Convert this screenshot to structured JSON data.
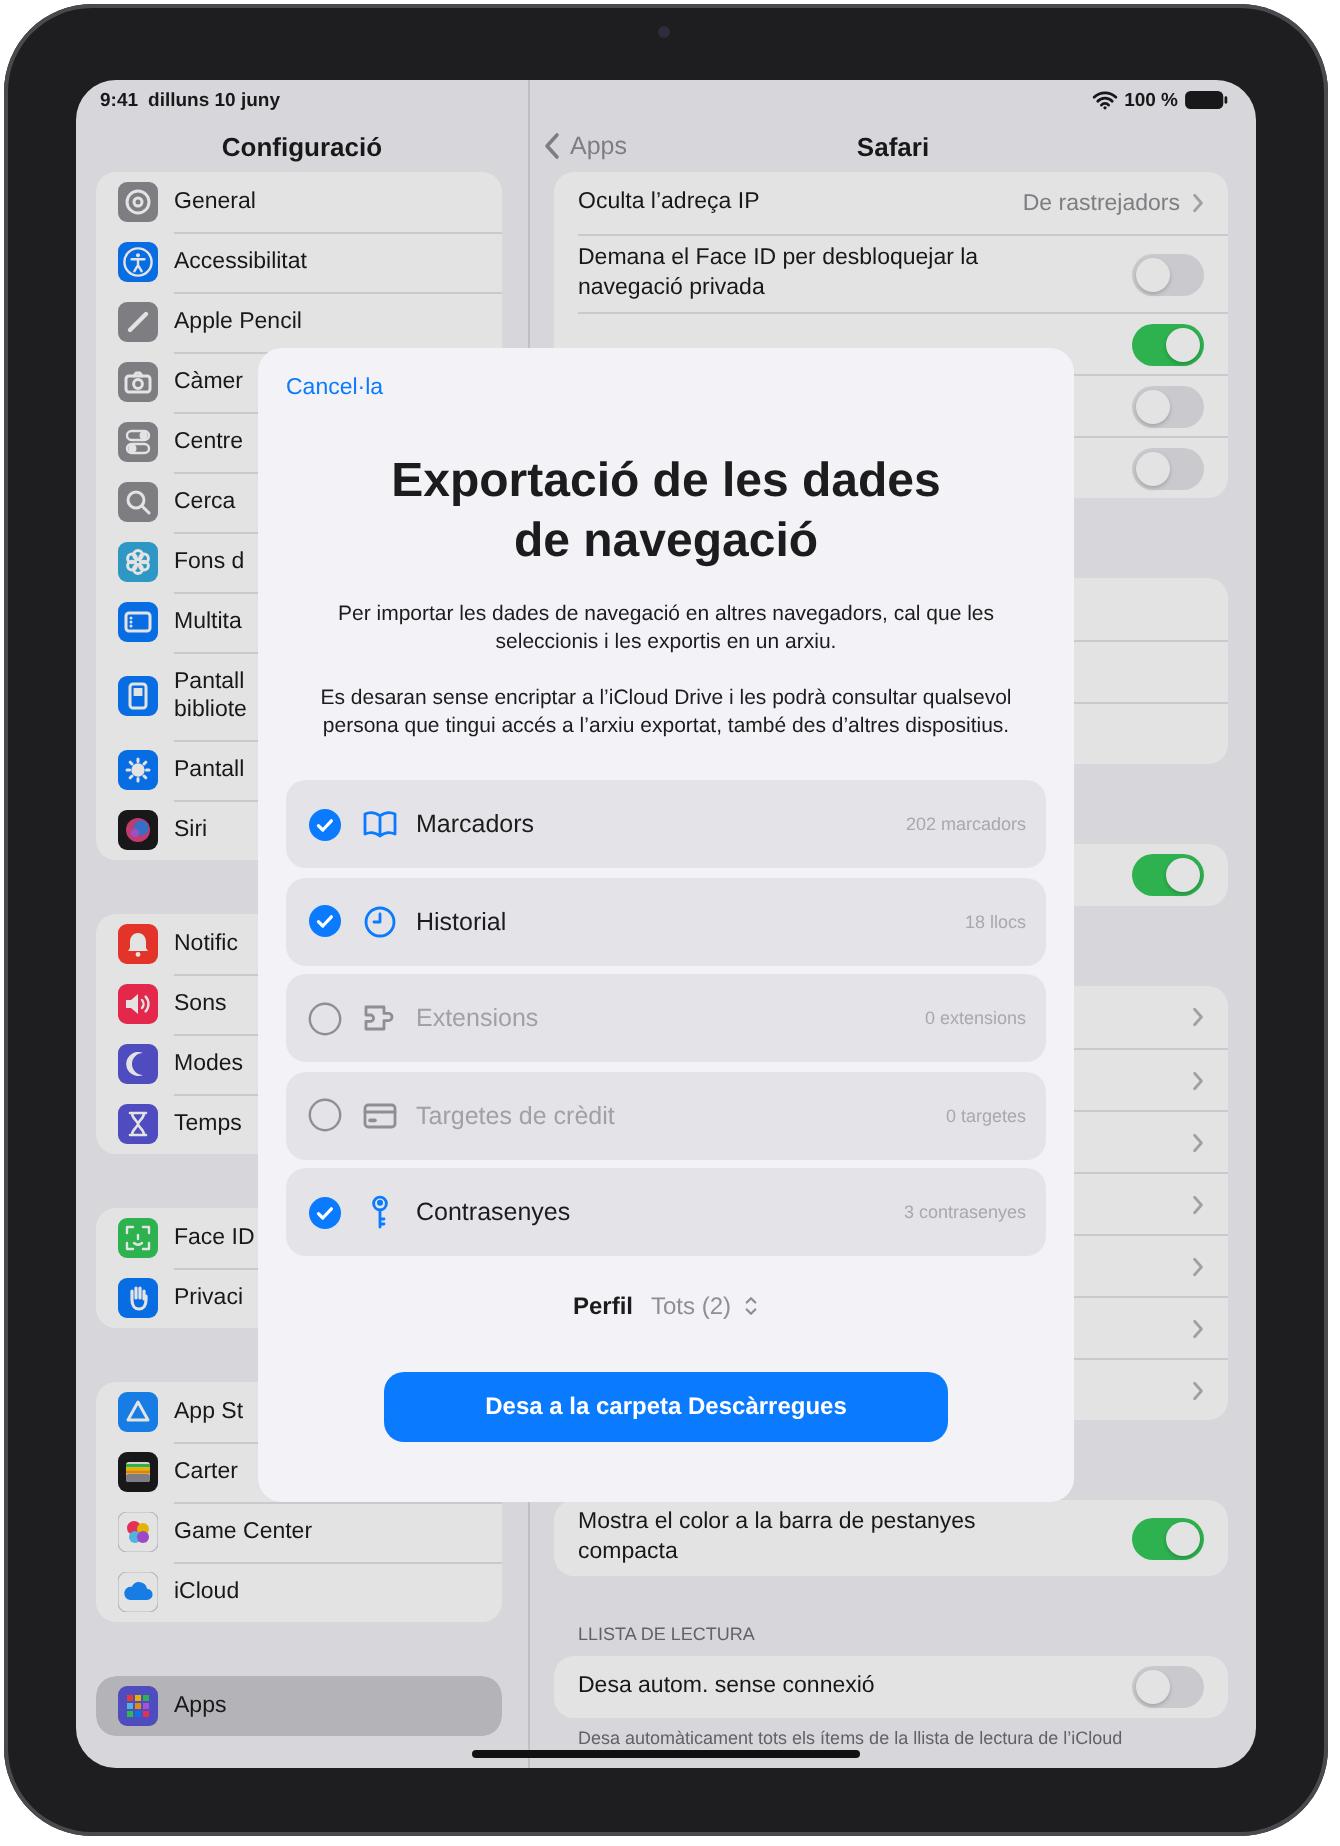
{
  "status_bar": {
    "time": "9:41",
    "date": "dilluns 10 juny",
    "battery": "100 %"
  },
  "sidebar": {
    "title": "Configuració",
    "groups": [
      {
        "items": [
          {
            "label": "General",
            "selected": false
          },
          {
            "label": "Accessibilitat",
            "selected": false
          },
          {
            "label": "Apple Pencil",
            "selected": false
          },
          {
            "label": "Càmer",
            "selected": false
          },
          {
            "label": "Centre",
            "selected": false
          },
          {
            "label": "Cerca",
            "selected": false
          },
          {
            "label": "Fons d",
            "selected": false
          },
          {
            "label": "Multita",
            "selected": false
          },
          {
            "label": "Pantall\nbibliote",
            "selected": false
          },
          {
            "label": "Pantall",
            "selected": false
          },
          {
            "label": "Siri",
            "selected": false
          }
        ]
      },
      {
        "items": [
          {
            "label": "Notific",
            "selected": false
          },
          {
            "label": "Sons",
            "selected": false
          },
          {
            "label": "Modes",
            "selected": false
          },
          {
            "label": "Temps",
            "selected": false
          }
        ]
      },
      {
        "items": [
          {
            "label": "Face ID",
            "selected": false
          },
          {
            "label": "Privaci",
            "selected": false
          }
        ]
      },
      {
        "items": [
          {
            "label": "App St",
            "selected": false
          },
          {
            "label": "Carter",
            "selected": false
          },
          {
            "label": "Game Center",
            "selected": false
          },
          {
            "label": "iCloud",
            "selected": false
          }
        ]
      },
      {
        "items": [
          {
            "label": "Apps",
            "selected": true
          }
        ]
      }
    ]
  },
  "detail": {
    "back": "Apps",
    "title": "Safari",
    "groups": [
      {
        "rows": [
          {
            "kind": "value",
            "label": "Oculta l’adreça IP",
            "value": "De rastrejadors"
          },
          {
            "kind": "toggle",
            "label": "Demana el Face ID per desbloquejar la navegació privada",
            "on": false
          },
          {
            "kind": "toggle",
            "on": true
          },
          {
            "kind": "toggle",
            "on": false
          },
          {
            "kind": "toggle",
            "on": false
          }
        ]
      },
      {
        "rows": [
          {
            "kind": "blank"
          },
          {
            "kind": "blank"
          },
          {
            "kind": "blank"
          }
        ]
      },
      {
        "rows": [
          {
            "kind": "toggle",
            "on": true
          }
        ]
      },
      {
        "rows": [
          {
            "kind": "chevron"
          },
          {
            "kind": "chevron"
          },
          {
            "kind": "chevron"
          },
          {
            "kind": "chevron"
          },
          {
            "kind": "chevron"
          },
          {
            "kind": "chevron"
          },
          {
            "kind": "chevron"
          }
        ]
      },
      {
        "rows": [
          {
            "kind": "toggle",
            "label": "Mostra el color a la barra de pestanyes compacta",
            "on": true
          }
        ]
      },
      {
        "header": "LLISTA DE LECTURA",
        "rows": [
          {
            "kind": "toggle",
            "label": "Desa autom. sense connexió",
            "on": false
          }
        ],
        "footer": "Desa automàticament tots els ítems de la llista de lectura de l’iCloud"
      }
    ]
  },
  "dialog": {
    "cancel": "Cancel·la",
    "title": "Exportació de les dades de navegació",
    "paragraphs": [
      "Per importar les dades de navegació en altres navegadors, cal que les seleccionis i les exportis en un arxiu.",
      "Es desaran sense encriptar a l’iCloud Drive i les podrà consultar qualsevol persona que tingui accés a l’arxiu exportat, també des d’altres dispositius."
    ],
    "items": [
      {
        "label": "Marcadors",
        "count": "202 marcadors",
        "checked": true,
        "disabled": false
      },
      {
        "label": "Historial",
        "count": "18 llocs",
        "checked": true,
        "disabled": false
      },
      {
        "label": "Extensions",
        "count": "0 extensions",
        "checked": false,
        "disabled": true
      },
      {
        "label": "Targetes de crèdit",
        "count": "0 targetes",
        "checked": false,
        "disabled": true
      },
      {
        "label": "Contrasenyes",
        "count": "3 contrasenyes",
        "checked": true,
        "disabled": false
      }
    ],
    "profile": {
      "label": "Perfil",
      "value": "Tots (2)"
    },
    "button": "Desa a la carpeta Descàrregues"
  }
}
